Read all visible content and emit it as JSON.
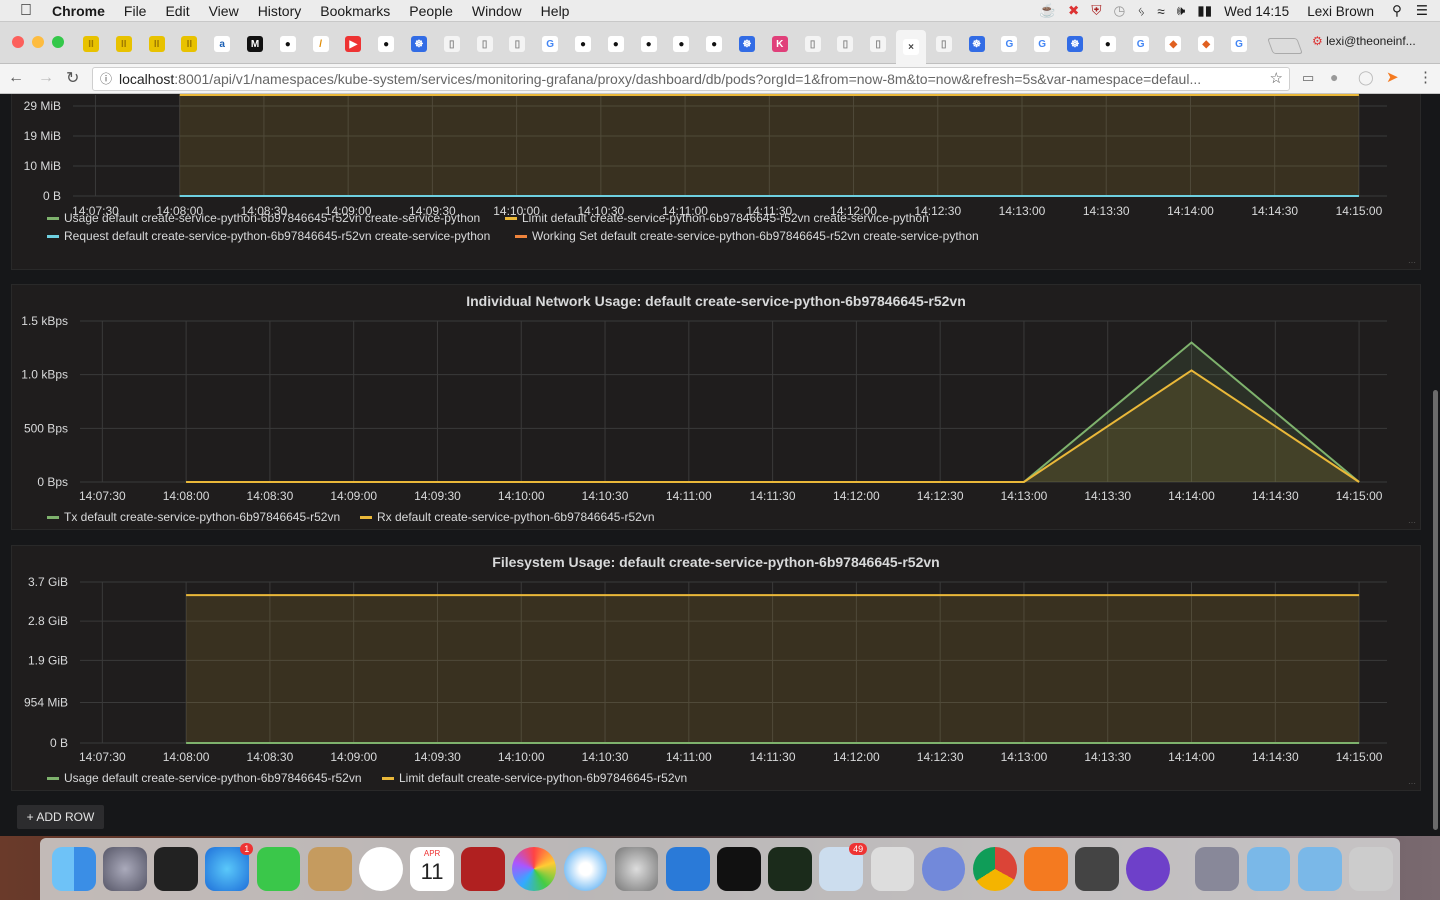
{
  "menubar": {
    "app": "Chrome",
    "items": [
      "File",
      "Edit",
      "View",
      "History",
      "Bookmarks",
      "People",
      "Window",
      "Help"
    ],
    "clock": "Wed 14:15",
    "user": "Lexi Brown"
  },
  "browser": {
    "url_host": "localhost",
    "url_path": ":8001/api/v1/namespaces/kube-system/services/monitoring-grafana/proxy/dashboard/db/pods?orgId=1&from=now-8m&to=now&refresh=5s&var-namespace=defaul...",
    "profile": "lexi@theoneinf...",
    "tabs": [
      "pause",
      "pause",
      "pause",
      "pause",
      "a",
      "M",
      "github",
      "pencil",
      "youtube",
      "github",
      "k8s",
      "doc",
      "doc",
      "doc",
      "google",
      "github",
      "github",
      "github",
      "github",
      "github",
      "k8s",
      "k-pink",
      "doc",
      "doc",
      "doc",
      "active",
      "doc",
      "k8s",
      "google",
      "google",
      "k8s",
      "github",
      "google",
      "fox",
      "fox",
      "google"
    ]
  },
  "colors": {
    "green": "#7eb26d",
    "yellow": "#eab839",
    "cyan": "#6ed0e0",
    "orange": "#ef843c",
    "panel_bg": "#1f1d1d",
    "grid": "#3a3a3a"
  },
  "x_ticks": [
    "14:07:30",
    "14:08:00",
    "14:08:30",
    "14:09:00",
    "14:09:30",
    "14:10:00",
    "14:10:30",
    "14:11:00",
    "14:11:30",
    "14:12:00",
    "14:12:30",
    "14:13:00",
    "14:13:30",
    "14:14:00",
    "14:14:30",
    "14:15:00"
  ],
  "panels": {
    "memory": {
      "title": "",
      "y_ticks": [
        "29 MiB",
        "19 MiB",
        "10 MiB",
        "0 B"
      ],
      "legend": [
        "Usage default create-service-python-6b97846645-r52vn create-service-python",
        "Limit default create-service-python-6b97846645-r52vn create-service-python",
        "Request default create-service-python-6b97846645-r52vn create-service-python",
        "Working Set default create-service-python-6b97846645-r52vn create-service-python"
      ]
    },
    "network": {
      "title": "Individual Network Usage: default create-service-python-6b97846645-r52vn",
      "y_ticks": [
        "1.5 kBps",
        "1.0 kBps",
        "500 Bps",
        "0 Bps"
      ],
      "legend": [
        "Tx default create-service-python-6b97846645-r52vn",
        "Rx default create-service-python-6b97846645-r52vn"
      ]
    },
    "filesystem": {
      "title": "Filesystem Usage: default create-service-python-6b97846645-r52vn",
      "y_ticks": [
        "3.7 GiB",
        "2.8 GiB",
        "1.9 GiB",
        "954 MiB",
        "0 B"
      ],
      "legend": [
        "Usage default create-service-python-6b97846645-r52vn",
        "Limit default create-service-python-6b97846645-r52vn"
      ]
    }
  },
  "add_row": "+ ADD ROW",
  "chart_data": [
    {
      "type": "area",
      "title": "",
      "x": [
        "14:08:00",
        "14:15:00"
      ],
      "ylim": [
        0,
        32
      ],
      "yunit": "MiB",
      "series": [
        {
          "name": "Limit default create-service-python-6b97846645-r52vn create-service-python",
          "values": [
            32,
            32
          ]
        },
        {
          "name": "Usage default create-service-python-6b97846645-r52vn create-service-python",
          "values": [
            0,
            0
          ]
        },
        {
          "name": "Request default create-service-python-6b97846645-r52vn create-service-python",
          "values": [
            0,
            0
          ]
        }
      ]
    },
    {
      "type": "line",
      "title": "Individual Network Usage: default create-service-python-6b97846645-r52vn",
      "x": [
        "14:08:00",
        "14:13:00",
        "14:14:00",
        "14:15:00"
      ],
      "ylim": [
        0,
        1.5
      ],
      "yunit": "kBps",
      "series": [
        {
          "name": "Tx default create-service-python-6b97846645-r52vn",
          "values": [
            0,
            0,
            1.3,
            0
          ]
        },
        {
          "name": "Rx default create-service-python-6b97846645-r52vn",
          "values": [
            0,
            0,
            1.04,
            0
          ]
        }
      ]
    },
    {
      "type": "area",
      "title": "Filesystem Usage: default create-service-python-6b97846645-r52vn",
      "x": [
        "14:08:00",
        "14:15:00"
      ],
      "ylim": [
        0,
        3.7
      ],
      "yunit": "GiB",
      "series": [
        {
          "name": "Limit default create-service-python-6b97846645-r52vn",
          "values": [
            3.4,
            3.4
          ]
        },
        {
          "name": "Usage default create-service-python-6b97846645-r52vn",
          "values": [
            0,
            0
          ]
        }
      ]
    }
  ],
  "dock": {
    "badges": {
      "appstore": "1",
      "mail": "49"
    },
    "calendar_month": "APR",
    "calendar_day": "11"
  }
}
